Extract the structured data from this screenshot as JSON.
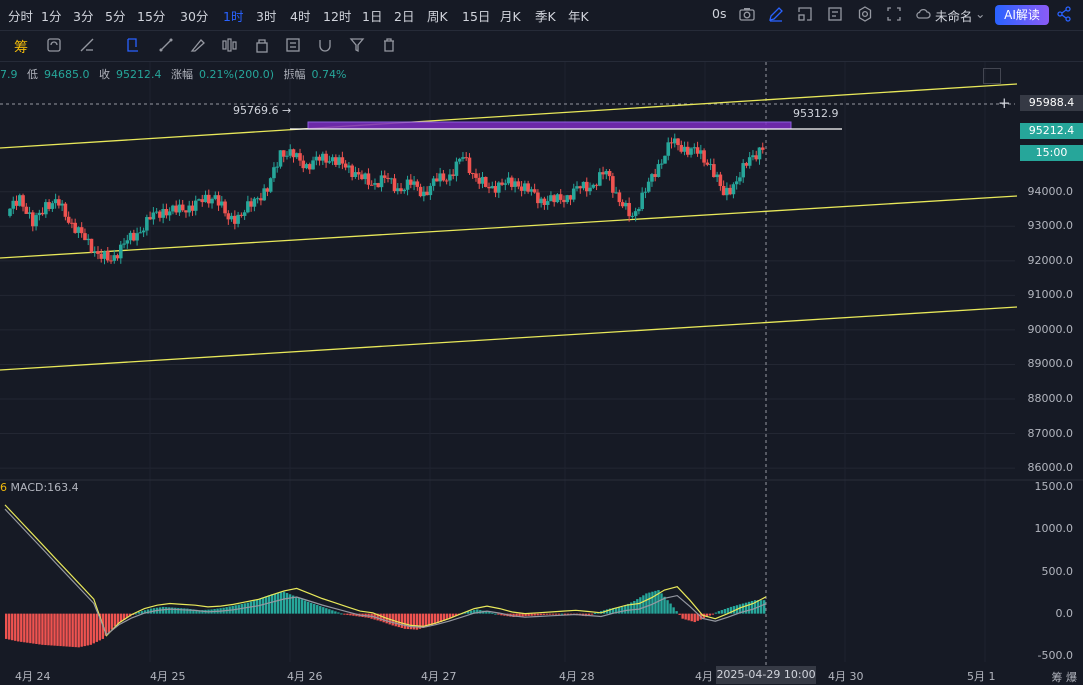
{
  "toolbar_top": {
    "timeframes": [
      "分时",
      "1分",
      "3分",
      "5分",
      "15分",
      "30分",
      "1时",
      "3时",
      "4时",
      "12时",
      "1日",
      "2日",
      "周K",
      "15日",
      "月K",
      "季K",
      "年K"
    ],
    "active": "1时",
    "countdown": "0s",
    "layout_name": "未命名",
    "ai_label": "AI解读"
  },
  "toolbar_draw": {
    "logo": "筹"
  },
  "ohlc": {
    "high_partial": "7.9",
    "low_label": "低",
    "low": "94685.0",
    "close_label": "收",
    "close": "95212.4",
    "change_label": "涨幅",
    "change": "0.21%(200.0)",
    "amp_label": "振幅",
    "amp": "0.74%"
  },
  "annotations": {
    "high_marker": "95769.6 →",
    "rect_label": "95312.9",
    "crosshair_price": "95988.4",
    "last_price": "95212.4",
    "countdown_box": "15:00"
  },
  "macd": {
    "prefix": "6",
    "label": "MACD:163.4"
  },
  "x_axis": {
    "labels": [
      "4月 24",
      "4月 25",
      "4月 26",
      "4月 27",
      "4月 28",
      "4月",
      "4月 30",
      "5月 1"
    ],
    "crosshair_time": "2025-04-29 10:00"
  },
  "bottom_right": "筹 爆",
  "colors": {
    "up": "#26a69a",
    "down": "#ef5350",
    "channel": "#e8e85a",
    "rect": "#7b2cbf",
    "macd_line": "#e8e85a",
    "signal_line": "#9598a1"
  },
  "chart_data": {
    "type": "candlestick",
    "y_axis_labels": [
      "95988.4",
      "95212.4",
      "94000.0",
      "93000.0",
      "92000.0",
      "91000.0",
      "90000.0",
      "89000.0",
      "88000.0",
      "87000.0",
      "86000.0"
    ],
    "ylim": [
      85800,
      96800
    ],
    "macd_axis_labels": [
      "1500.0",
      "1000.0",
      "500.0",
      "0.0",
      "-500.0"
    ],
    "macd_ylim": [
      -550,
      1550
    ],
    "x_categories": [
      "4月 24",
      "4月 25",
      "4月 26",
      "4月 27",
      "4月 28",
      "4月 29",
      "4月 30",
      "5月 1"
    ],
    "close_path": [
      93300,
      93900,
      93000,
      93700,
      93600,
      93100,
      92600,
      92200,
      92000,
      92500,
      92800,
      93200,
      93500,
      93400,
      93600,
      93700,
      93900,
      93200,
      93300,
      93800,
      94000,
      95200,
      95000,
      94800,
      94900,
      95000,
      94700,
      94500,
      94200,
      94400,
      94100,
      94200,
      94000,
      94300,
      94500,
      95000,
      94400,
      94100,
      94200,
      94300,
      94000,
      93800,
      93700,
      93900,
      94100,
      94200,
      94600,
      93700,
      93300,
      94000,
      94800,
      95400,
      95300,
      95100,
      94800,
      93900,
      94300,
      95000,
      95212
    ],
    "macd_hist": [
      -300,
      -330,
      -350,
      -370,
      -380,
      -390,
      -400,
      -370,
      -300,
      -150,
      -50,
      20,
      60,
      80,
      70,
      60,
      40,
      50,
      70,
      100,
      130,
      180,
      230,
      260,
      200,
      140,
      90,
      40,
      -10,
      -30,
      -50,
      -90,
      -140,
      -180,
      -190,
      -150,
      -100,
      -40,
      20,
      50,
      20,
      -20,
      -40,
      -30,
      -20,
      -10,
      0,
      -15,
      -30,
      20,
      60,
      80,
      150,
      240,
      280,
      120,
      -60,
      -100,
      -40,
      30,
      80,
      120,
      160
    ]
  }
}
